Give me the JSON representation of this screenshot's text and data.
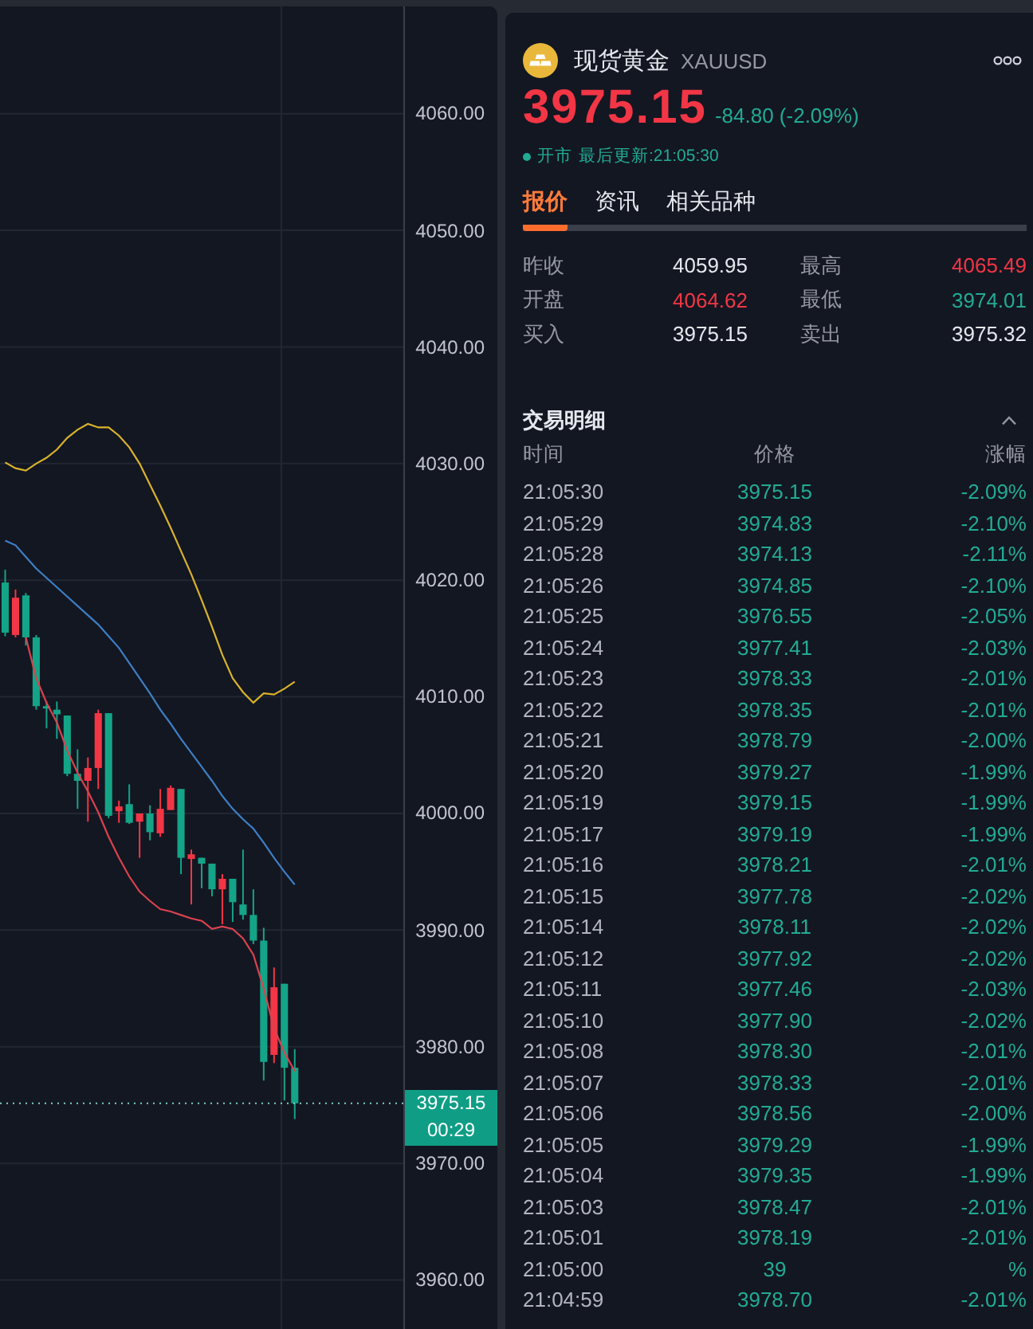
{
  "chart": {
    "chart_data": {
      "type": "candlestick",
      "categories": [
        null,
        null,
        null,
        null,
        null,
        null,
        null,
        null,
        null,
        null,
        null,
        null,
        null,
        null,
        null,
        null,
        null,
        null,
        null,
        null,
        null,
        null,
        null,
        null,
        null,
        null,
        null,
        null,
        null,
        null,
        null,
        null,
        null,
        null,
        null,
        null,
        null,
        null,
        null
      ],
      "ylim": [
        3955.8,
        4069.2
      ],
      "grid": true,
      "yticks": [
        {
          "value": 4060,
          "label": "4060.00"
        },
        {
          "value": 4050,
          "label": "4050.00"
        },
        {
          "value": 4040,
          "label": "4040.00"
        },
        {
          "value": 4030,
          "label": "4030.00"
        },
        {
          "value": 4020,
          "label": "4020.00"
        },
        {
          "value": 4010,
          "label": "4010.00"
        },
        {
          "value": 4000,
          "label": "4000.00"
        },
        {
          "value": 3990,
          "label": "3990.00"
        },
        {
          "value": 3980,
          "label": "3980.00"
        },
        {
          "value": 3970,
          "label": "3970.00"
        },
        {
          "value": 3960,
          "label": "3960.00"
        }
      ],
      "ohlc": [
        [
          4019.8,
          4020.9,
          4015.2,
          4015.5
        ],
        [
          4015.3,
          4019.2,
          4015.1,
          4018.5
        ],
        [
          4018.7,
          4018.9,
          4014.4,
          4015.1
        ],
        [
          4015.1,
          4015.3,
          4008.9,
          4009.2
        ],
        [
          4009.2,
          4009.6,
          4007.3,
          4009.0
        ],
        [
          4008.9,
          4009.6,
          4006.4,
          4008.5
        ],
        [
          4008.4,
          4008.4,
          4003.2,
          4003.4
        ],
        [
          4003.4,
          4005.5,
          4000.4,
          4002.8
        ],
        [
          4002.8,
          4004.8,
          3999.3,
          4003.9
        ],
        [
          4003.9,
          4008.9,
          4002.1,
          4008.6
        ],
        [
          4008.6,
          4008.6,
          3999.6,
          3999.8
        ],
        [
          4000.2,
          4001.1,
          3999.2,
          4000.6
        ],
        [
          4000.8,
          4002.5,
          3999.1,
          3999.2
        ],
        [
          3999.3,
          4000.0,
          3996.2,
          4000.0
        ],
        [
          4000.0,
          4000.7,
          3997.7,
          3998.4
        ],
        [
          3998.3,
          4002.1,
          3998.0,
          4000.4
        ],
        [
          4000.3,
          4002.4,
          4000.3,
          4002.2
        ],
        [
          4002.1,
          4002.1,
          3994.8,
          3996.2
        ],
        [
          3996.1,
          3996.9,
          3992.2,
          3996.5
        ],
        [
          3996.2,
          3996.2,
          3993.6,
          3995.7
        ],
        [
          3995.7,
          3995.7,
          3992.9,
          3993.5
        ],
        [
          3993.5,
          3994.8,
          3990.5,
          3994.4
        ],
        [
          3994.4,
          3994.4,
          3990.7,
          3992.4
        ],
        [
          3992.2,
          3996.9,
          3990.9,
          3991.3
        ],
        [
          3991.3,
          3993.5,
          3988.8,
          3989.1
        ],
        [
          3989.1,
          3990.2,
          3977.1,
          3978.7
        ],
        [
          3979.3,
          3986.8,
          3978.6,
          3985.1
        ],
        [
          3985.4,
          3985.4,
          3975.4,
          3978.2
        ],
        [
          3978.2,
          3979.8,
          3973.8,
          3975.15
        ],
        null,
        null,
        null,
        null,
        null,
        null,
        null,
        null,
        null,
        null
      ],
      "series": [
        {
          "type": "line",
          "color": "#d9b32b",
          "values": [
            4030.1,
            4029.6,
            4029.4,
            4030.0,
            4030.5,
            4031.2,
            4032.2,
            4032.9,
            4033.4,
            4033.1,
            4033.1,
            4032.4,
            4031.4,
            4030.0,
            4028.2,
            4026.4,
            4024.5,
            4022.5,
            4020.5,
            4018.3,
            4016.0,
            4013.6,
            4011.6,
            4010.4,
            4009.5,
            4010.3,
            4010.2,
            4010.7,
            4011.3,
            null,
            null,
            null,
            null,
            null,
            null,
            null,
            null,
            null,
            null
          ]
        },
        {
          "type": "line",
          "color": "#3d7fc4",
          "values": [
            4023.4,
            4023.0,
            4022.0,
            4021.0,
            4020.2,
            4019.4,
            4018.6,
            4017.8,
            4017.0,
            4016.2,
            4015.2,
            4014.2,
            4012.9,
            4011.6,
            4010.3,
            4008.9,
            4007.7,
            4006.4,
            4005.2,
            4004.0,
            4002.8,
            4001.5,
            4000.4,
            3999.5,
            3998.7,
            3997.5,
            3996.2,
            3995.0,
            3993.9,
            null,
            null,
            null,
            null,
            null,
            null,
            null,
            null,
            null,
            null
          ]
        },
        {
          "type": "line",
          "color": "#d9434f",
          "values": [
            null,
            null,
            4015.1,
            4011.6,
            4009.5,
            4007.8,
            4005.4,
            4003.5,
            4001.9,
            4000.1,
            3998.0,
            3996.2,
            3994.6,
            3993.3,
            3992.5,
            3991.8,
            3991.6,
            3991.3,
            3991.0,
            3990.8,
            3990.1,
            3990.3,
            3990.1,
            3989.3,
            3987.9,
            3985.0,
            3981.6,
            3979.5,
            3977.9,
            null,
            null,
            null,
            null,
            null,
            null,
            null,
            null,
            null,
            null
          ]
        }
      ],
      "ref_lines": [
        {
          "axis": "y",
          "value": 3975.15
        }
      ]
    },
    "last_price": {
      "price": "3975.15",
      "countdown": "00:29"
    }
  },
  "quote": {
    "name": "现货黄金",
    "symbol": "XAUUSD",
    "price": "3975.15",
    "change": "-84.80 (-2.09%)",
    "market_status": {
      "open": true,
      "label": "开市",
      "updated": "最后更新:21:05:30"
    },
    "tabs": [
      {
        "label": "报价",
        "selected": true
      },
      {
        "label": "资讯",
        "selected": false
      },
      {
        "label": "相关品种",
        "selected": false
      }
    ],
    "stats": [
      {
        "label": "昨收",
        "value": "4059.95",
        "color": "#e6e8ee"
      },
      {
        "label": "最高",
        "value": "4065.49",
        "color": "#f23645"
      },
      {
        "label": "开盘",
        "value": "4064.62",
        "color": "#f23645"
      },
      {
        "label": "最低",
        "value": "3974.01",
        "color": "#22ab94"
      },
      {
        "label": "买入",
        "value": "3975.15",
        "color": "#e6e8ee"
      },
      {
        "label": "卖出",
        "value": "3975.32",
        "color": "#e6e8ee"
      }
    ],
    "trades": {
      "title": "交易明细",
      "expanded": true,
      "columns": [
        "时间",
        "价格",
        "涨幅"
      ],
      "rows": [
        {
          "time": "21:05:30",
          "price": "3975.15",
          "change": "-2.09%"
        },
        {
          "time": "21:05:29",
          "price": "3974.83",
          "change": "-2.10%"
        },
        {
          "time": "21:05:28",
          "price": "3974.13",
          "change": "-2.11%"
        },
        {
          "time": "21:05:26",
          "price": "3974.85",
          "change": "-2.10%"
        },
        {
          "time": "21:05:25",
          "price": "3976.55",
          "change": "-2.05%"
        },
        {
          "time": "21:05:24",
          "price": "3977.41",
          "change": "-2.03%"
        },
        {
          "time": "21:05:23",
          "price": "3978.33",
          "change": "-2.01%"
        },
        {
          "time": "21:05:22",
          "price": "3978.35",
          "change": "-2.01%"
        },
        {
          "time": "21:05:21",
          "price": "3978.79",
          "change": "-2.00%"
        },
        {
          "time": "21:05:20",
          "price": "3979.27",
          "change": "-1.99%"
        },
        {
          "time": "21:05:19",
          "price": "3979.15",
          "change": "-1.99%"
        },
        {
          "time": "21:05:17",
          "price": "3979.19",
          "change": "-1.99%"
        },
        {
          "time": "21:05:16",
          "price": "3978.21",
          "change": "-2.01%"
        },
        {
          "time": "21:05:15",
          "price": "3977.78",
          "change": "-2.02%"
        },
        {
          "time": "21:05:14",
          "price": "3978.11",
          "change": "-2.02%"
        },
        {
          "time": "21:05:12",
          "price": "3977.92",
          "change": "-2.02%"
        },
        {
          "time": "21:05:11",
          "price": "3977.46",
          "change": "-2.03%"
        },
        {
          "time": "21:05:10",
          "price": "3977.90",
          "change": "-2.02%"
        },
        {
          "time": "21:05:08",
          "price": "3978.30",
          "change": "-2.01%"
        },
        {
          "time": "21:05:07",
          "price": "3978.33",
          "change": "-2.01%"
        },
        {
          "time": "21:05:06",
          "price": "3978.56",
          "change": "-2.00%"
        },
        {
          "time": "21:05:05",
          "price": "3979.29",
          "change": "-1.99%"
        },
        {
          "time": "21:05:04",
          "price": "3979.35",
          "change": "-1.99%"
        },
        {
          "time": "21:05:03",
          "price": "3978.47",
          "change": "-2.01%"
        },
        {
          "time": "21:05:01",
          "price": "3978.19",
          "change": "-2.01%"
        },
        {
          "time": "21:05:00",
          "price": "39",
          "change": "%"
        },
        {
          "time": "21:04:59",
          "price": "3978.70",
          "change": "-2.01%"
        }
      ]
    }
  }
}
